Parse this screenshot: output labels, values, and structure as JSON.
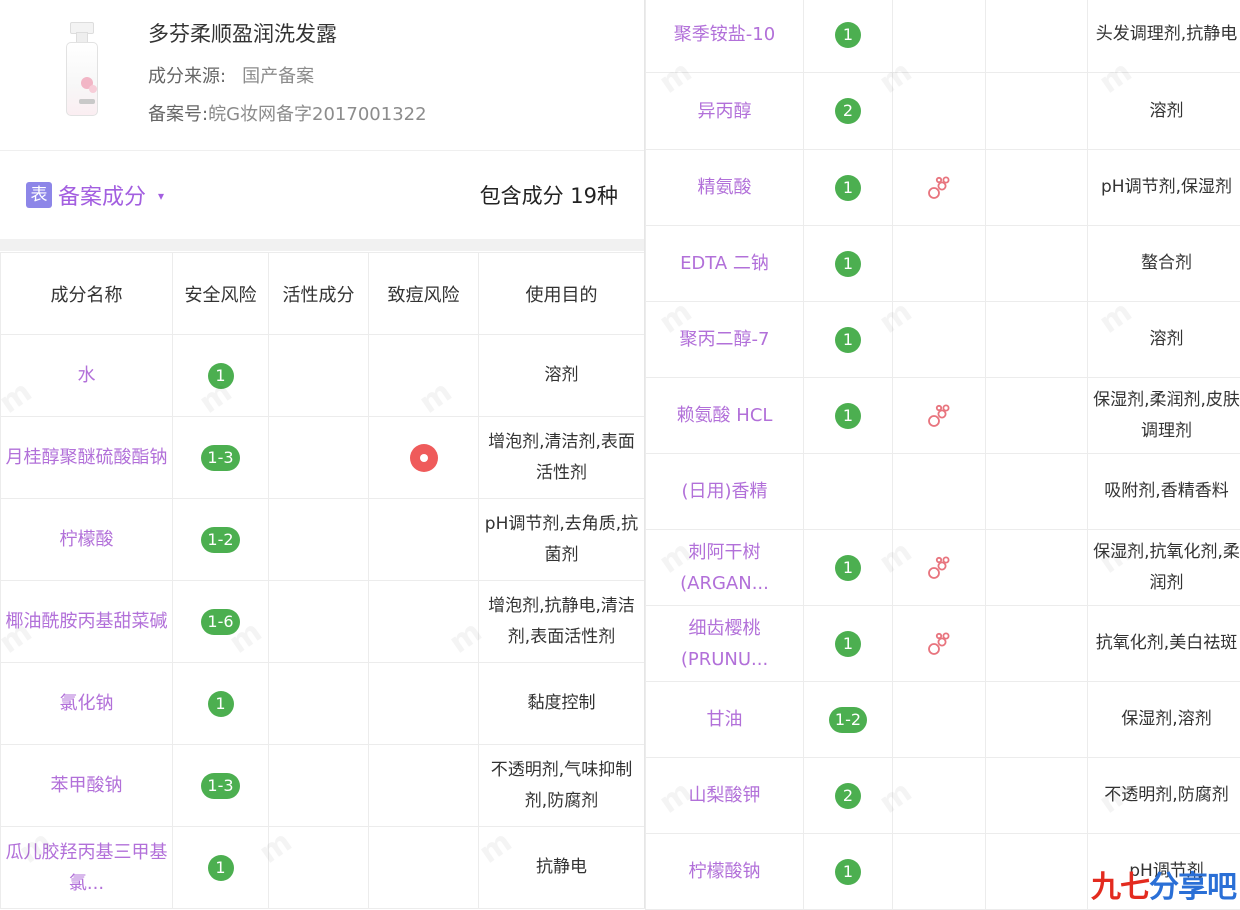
{
  "product": {
    "name": "多芬柔顺盈润洗发露",
    "source_label": "成分来源:",
    "source_value": "国产备案",
    "registration_label": "备案号:",
    "registration_value": "皖G妆网备字2017001322"
  },
  "section": {
    "icon_text": "表",
    "title": "备案成分",
    "caret": "▾",
    "count_text": "包含成分 19种"
  },
  "table": {
    "headers": [
      "成分名称",
      "安全风险",
      "活性成分",
      "致痘风险",
      "使用目的"
    ]
  },
  "colors": {
    "ingredient_name": "#b270d9",
    "safety_badge": "#4caf50",
    "acne_risk": "#ef5b5b",
    "active_icon": "#e8747e",
    "section_title": "#a35fe0"
  },
  "left_rows": [
    {
      "name": "水",
      "safety": "1",
      "active": false,
      "acne": false,
      "purpose": "溶剂"
    },
    {
      "name": "月桂醇聚醚硫酸酯钠",
      "safety": "1-3",
      "active": false,
      "acne": true,
      "purpose": "增泡剂,清洁剂,表面活性剂"
    },
    {
      "name": "柠檬酸",
      "safety": "1-2",
      "active": false,
      "acne": false,
      "purpose": "pH调节剂,去角质,抗菌剂"
    },
    {
      "name": "椰油酰胺丙基甜菜碱",
      "safety": "1-6",
      "active": false,
      "acne": false,
      "purpose": "增泡剂,抗静电,清洁剂,表面活性剂"
    },
    {
      "name": "氯化钠",
      "safety": "1",
      "active": false,
      "acne": false,
      "purpose": "黏度控制"
    },
    {
      "name": "苯甲酸钠",
      "safety": "1-3",
      "active": false,
      "acne": false,
      "purpose": "不透明剂,气味抑制剂,防腐剂"
    },
    {
      "name": "瓜儿胶羟丙基三甲基氯...",
      "safety": "1",
      "active": false,
      "acne": false,
      "purpose": "抗静电"
    }
  ],
  "right_rows": [
    {
      "name": "聚季铵盐-10",
      "safety": "1",
      "active": false,
      "acne": false,
      "purpose": "头发调理剂,抗静电"
    },
    {
      "name": "异丙醇",
      "safety": "2",
      "active": false,
      "acne": false,
      "purpose": "溶剂"
    },
    {
      "name": "精氨酸",
      "safety": "1",
      "active": true,
      "acne": false,
      "purpose": "pH调节剂,保湿剂"
    },
    {
      "name": "EDTA 二钠",
      "safety": "1",
      "active": false,
      "acne": false,
      "purpose": "螯合剂"
    },
    {
      "name": "聚丙二醇-7",
      "safety": "1",
      "active": false,
      "acne": false,
      "purpose": "溶剂"
    },
    {
      "name": "赖氨酸 HCL",
      "safety": "1",
      "active": true,
      "acne": false,
      "purpose": "保湿剂,柔润剂,皮肤调理剂"
    },
    {
      "name": "(日用)香精",
      "safety": "",
      "active": false,
      "acne": false,
      "purpose": "吸附剂,香精香料"
    },
    {
      "name": "刺阿干树(ARGAN...",
      "safety": "1",
      "active": true,
      "acne": false,
      "purpose": "保湿剂,抗氧化剂,柔润剂"
    },
    {
      "name": "细齿樱桃(PRUNU...",
      "safety": "1",
      "active": true,
      "acne": false,
      "purpose": "抗氧化剂,美白祛斑"
    },
    {
      "name": "甘油",
      "safety": "1-2",
      "active": false,
      "acne": false,
      "purpose": "保湿剂,溶剂"
    },
    {
      "name": "山梨酸钾",
      "safety": "2",
      "active": false,
      "acne": false,
      "purpose": "不透明剂,防腐剂"
    },
    {
      "name": "柠檬酸钠",
      "safety": "1",
      "active": false,
      "acne": false,
      "purpose": "pH调节剂"
    }
  ],
  "icons": {
    "active": "bubbles-icon",
    "acne": "acne-risk-dot-icon"
  },
  "logo": {
    "text_a": "九七",
    "text_b": "分享吧"
  }
}
